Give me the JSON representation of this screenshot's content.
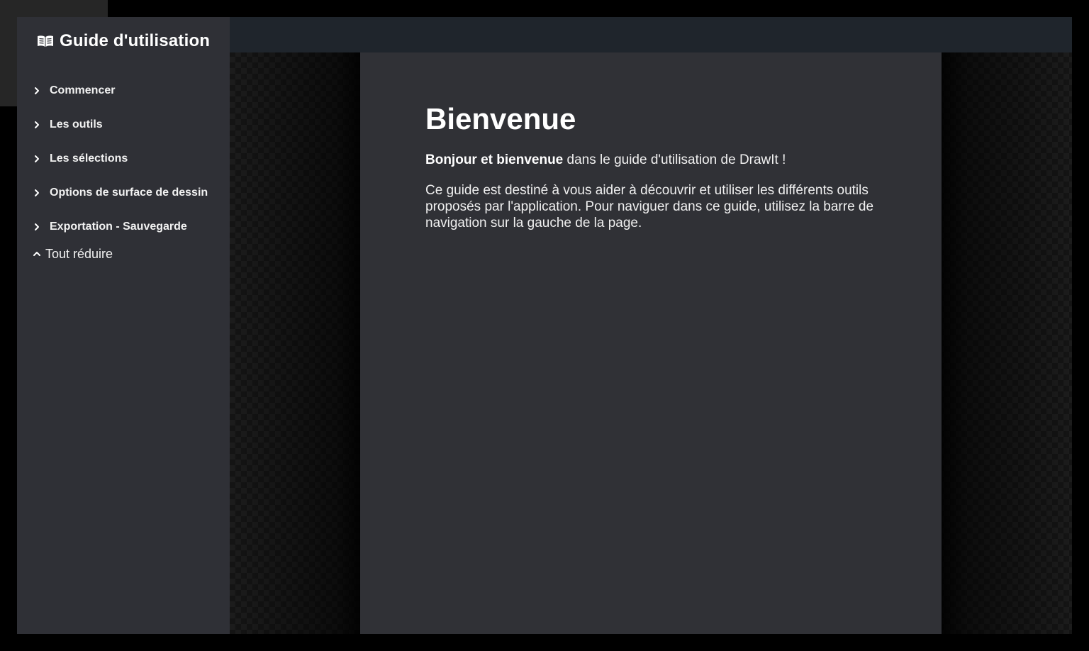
{
  "sidebar": {
    "title": "Guide d'utilisation",
    "title_icon": "book-open-icon",
    "items": [
      {
        "label": "Commencer",
        "icon": "chevron-right-icon"
      },
      {
        "label": "Les outils",
        "icon": "chevron-right-icon"
      },
      {
        "label": "Les sélections",
        "icon": "chevron-right-icon"
      },
      {
        "label": "Options de surface de dessin",
        "icon": "chevron-right-icon"
      },
      {
        "label": "Exportation - Sauvegarde",
        "icon": "chevron-right-icon"
      }
    ],
    "collapse_all": {
      "label": "Tout réduire",
      "icon": "chevron-up-icon"
    }
  },
  "content": {
    "title": "Bienvenue",
    "intro_bold": "Bonjour et bienvenue",
    "intro_rest": " dans le guide d'utilisation de DrawIt !",
    "paragraph": "Ce guide est destiné à vous aider à découvrir et utiliser les différents outils proposés par l'application. Pour naviguer dans ce guide, utilisez la barre de navigation sur la gauche de la page."
  },
  "colors": {
    "sidebar_bg": "#2f3036",
    "topbar_bg": "#1f252c",
    "content_bg": "#303136",
    "text": "#ffffff"
  }
}
